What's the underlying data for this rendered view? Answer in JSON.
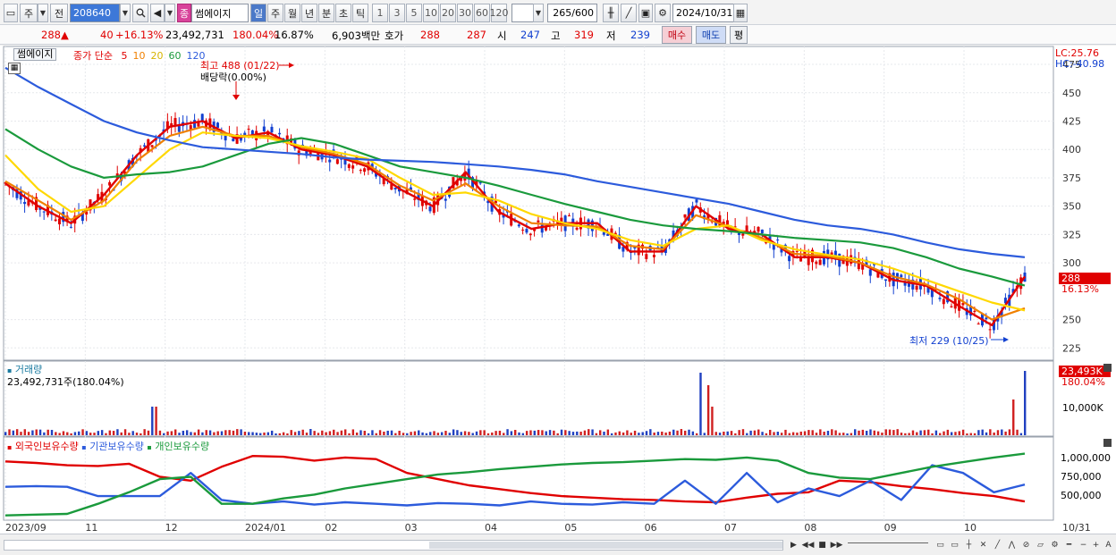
{
  "toolbar": {
    "market_label": "주",
    "prev_label": "전",
    "code": "208640",
    "search_icon": "search-icon",
    "stock_badge": "종",
    "stock_name": "썸에이지",
    "periods": [
      "일",
      "주",
      "월",
      "년",
      "분",
      "초",
      "틱"
    ],
    "active_period": "일",
    "intervals": [
      "1",
      "3",
      "5",
      "10",
      "20",
      "30",
      "60",
      "120"
    ],
    "count_value": "265",
    "count_total": "/600",
    "date_value": "2024/10/31"
  },
  "quote": {
    "price": "288",
    "change": "40",
    "change_pct": "+16.13%",
    "volume": "23,492,731",
    "volume_ratio": "180.04%",
    "turnover": "16.87%",
    "amount": "6,903백만",
    "hoga_label": "호가",
    "ask": "288",
    "bid": "287",
    "open_label": "시",
    "open": "247",
    "high_label": "고",
    "high": "319",
    "low_label": "저",
    "low": "239",
    "buy_label": "매수",
    "sell_label": "매도",
    "avg_label": "평"
  },
  "price_panel": {
    "name_tag": "썸에이지",
    "ma_label": "종가 단순",
    "ma_periods": [
      "5",
      "10",
      "20",
      "60",
      "120"
    ],
    "ma_colors": [
      "#e00000",
      "#f08000",
      "#ffd800",
      "#1a9a3c",
      "#2c5bdc"
    ],
    "high_annot": "최고 488 (01/22)",
    "ex_div_annot": "배당락(0.00%)",
    "low_annot": "최저 229 (10/25)",
    "lc": "LC:25.76",
    "hc": "HC:-40.98",
    "last_price_tag": "288",
    "last_change_tag": "16.13%",
    "y_ticks": [
      "475",
      "450",
      "425",
      "400",
      "375",
      "350",
      "325",
      "300",
      "250",
      "225"
    ]
  },
  "volume_panel": {
    "title": "거래량",
    "value_text": "23,492,731주(180.04%)",
    "last_tag": "23,493K",
    "last_pct": "180.04%",
    "y_tick": "10,000K"
  },
  "holdings_panel": {
    "legend": [
      "외국인보유수량",
      "기관보유수량",
      "개인보유수량"
    ],
    "colors": [
      "#e00000",
      "#2c5bdc",
      "#1a9a3c"
    ],
    "y_ticks": [
      "1,000,000",
      "750,000",
      "500,000"
    ]
  },
  "x_axis": {
    "labels": [
      "2023/09",
      "11",
      "12",
      "2024/01",
      "02",
      "03",
      "04",
      "05",
      "06",
      "07",
      "08",
      "09",
      "10"
    ],
    "last_label": "10/31"
  },
  "chart_data": {
    "type": "line",
    "y_range": [
      215,
      490
    ],
    "ma_series": [
      {
        "name": "5",
        "values": [
          370,
          350,
          335,
          360,
          395,
          420,
          425,
          410,
          415,
          400,
          395,
          385,
          365,
          350,
          380,
          345,
          330,
          335,
          335,
          310,
          310,
          350,
          330,
          325,
          305,
          305,
          300,
          285,
          280,
          262,
          245,
          288
        ]
      },
      {
        "name": "10",
        "values": [
          372,
          355,
          338,
          355,
          390,
          412,
          420,
          412,
          412,
          402,
          396,
          387,
          368,
          355,
          370,
          350,
          335,
          333,
          332,
          315,
          312,
          342,
          332,
          322,
          308,
          306,
          300,
          288,
          281,
          268,
          250,
          260
        ]
      },
      {
        "name": "20",
        "values": [
          395,
          365,
          345,
          350,
          375,
          400,
          415,
          412,
          410,
          403,
          398,
          392,
          375,
          360,
          362,
          355,
          343,
          335,
          330,
          320,
          315,
          330,
          333,
          320,
          312,
          307,
          303,
          295,
          285,
          275,
          265,
          258
        ]
      },
      {
        "name": "60",
        "values": [
          418,
          400,
          385,
          375,
          378,
          380,
          385,
          395,
          405,
          410,
          405,
          395,
          385,
          380,
          375,
          368,
          360,
          352,
          345,
          338,
          333,
          330,
          328,
          325,
          322,
          320,
          318,
          313,
          305,
          295,
          288,
          280
        ]
      },
      {
        "name": "120",
        "values": [
          472,
          455,
          440,
          425,
          415,
          408,
          402,
          400,
          398,
          396,
          393,
          391,
          390,
          389,
          387,
          385,
          382,
          378,
          372,
          367,
          362,
          357,
          352,
          345,
          338,
          333,
          330,
          325,
          318,
          312,
          308,
          305
        ]
      }
    ],
    "holdings_series": [
      {
        "name": "외국인보유수량",
        "values": [
          850,
          830,
          800,
          790,
          820,
          650,
          600,
          780,
          920,
          910,
          860,
          900,
          880,
          700,
          620,
          540,
          490,
          440,
          400,
          380,
          360,
          350,
          330,
          320,
          380,
          430,
          450,
          600,
          580,
          530,
          490,
          440,
          400,
          330
        ]
      },
      {
        "name": "기관보유수량",
        "values": [
          520,
          530,
          520,
          400,
          400,
          400,
          700,
          350,
          300,
          330,
          290,
          320,
          300,
          280,
          310,
          300,
          280,
          330,
          300,
          290,
          320,
          300,
          600,
          300,
          700,
          320,
          500,
          400,
          600,
          350,
          800,
          700,
          450,
          550
        ]
      },
      {
        "name": "개인보유수량",
        "values": [
          150,
          160,
          170,
          300,
          450,
          620,
          650,
          300,
          300,
          370,
          420,
          500,
          560,
          620,
          680,
          710,
          750,
          780,
          810,
          830,
          840,
          860,
          880,
          870,
          900,
          860,
          700,
          640,
          620,
          700,
          780,
          840,
          900,
          950
        ]
      }
    ]
  }
}
